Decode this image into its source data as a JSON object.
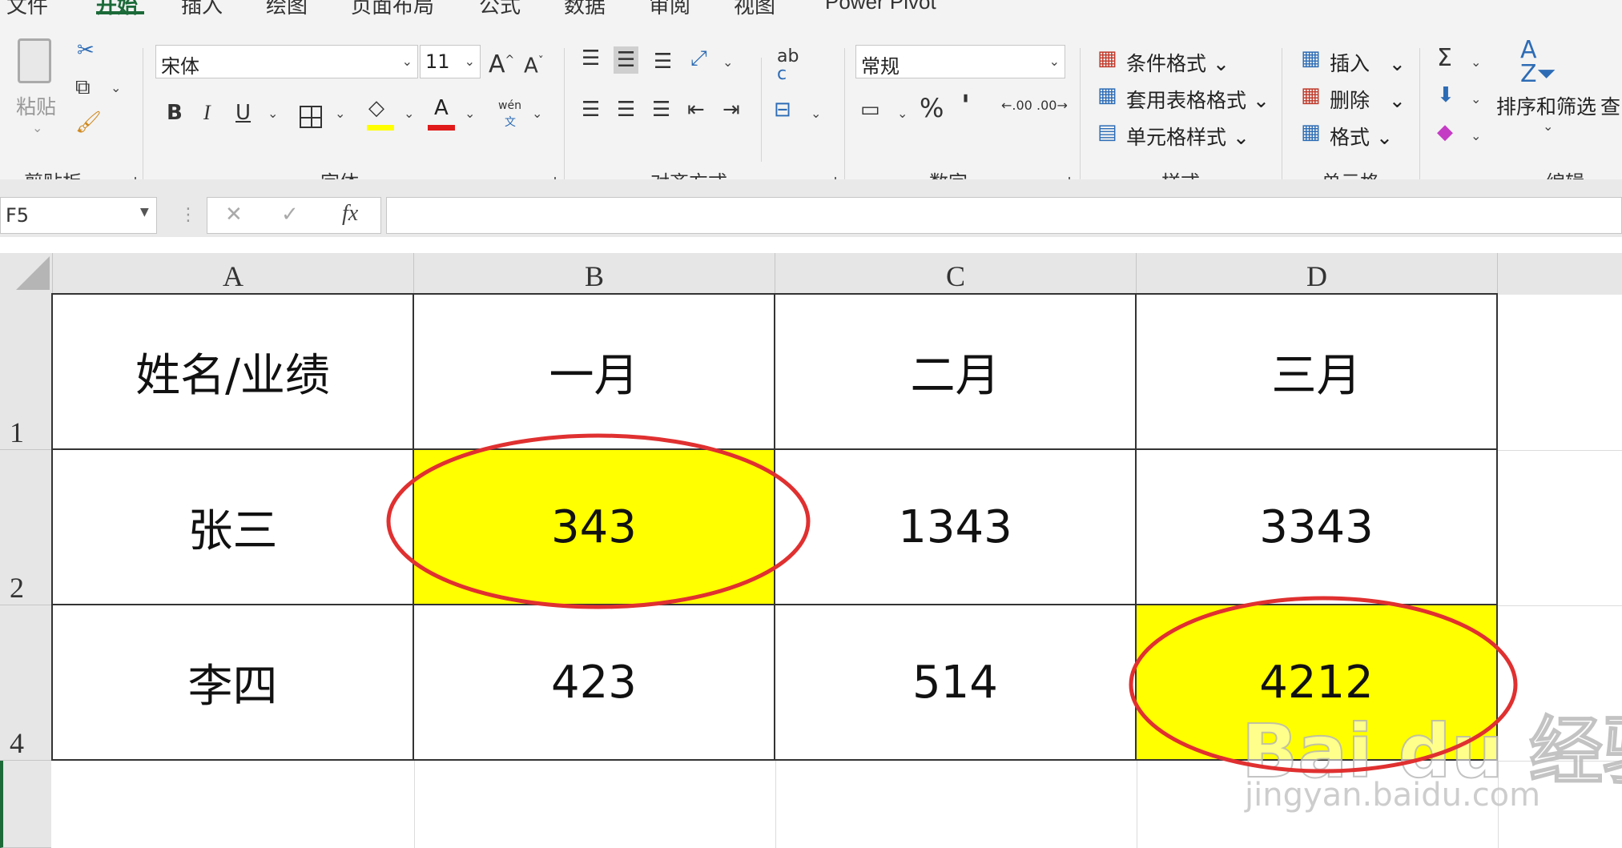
{
  "tabs": [
    "文件",
    "开始",
    "插入",
    "绘图",
    "页面布局",
    "公式",
    "数据",
    "审阅",
    "视图",
    "Power Pivot"
  ],
  "ribbon": {
    "clipboard": {
      "label": "剪贴板",
      "paste": "粘贴"
    },
    "font": {
      "label": "字体",
      "name": "宋体",
      "size": "11",
      "grow": "A",
      "shrink": "A",
      "bold": "B",
      "italic": "I",
      "underline": "U",
      "phonetic_top": "wén",
      "phonetic_bottom": "文",
      "font_color_letter": "A"
    },
    "align": {
      "label": "对齐方式",
      "wrap_top": "ab",
      "wrap_bottom": "c"
    },
    "number": {
      "label": "数字",
      "format": "常规",
      "percent": "%",
      "comma": "'",
      "inc_decimal": ".00",
      "dec_decimal": ".00"
    },
    "styles": {
      "label": "样式",
      "conditional": "条件格式",
      "table": "套用表格格式",
      "cell": "单元格样式"
    },
    "cells": {
      "label": "单元格",
      "insert": "插入",
      "delete": "删除",
      "format": "格式"
    },
    "editing": {
      "label": "编辑",
      "sum": "Σ",
      "sort": "排序和筛选",
      "find": "查"
    },
    "colors": {
      "accent": "#1b6a38",
      "highlight": "#ffff00",
      "font_red": "#e01a1a"
    }
  },
  "formula_bar": {
    "name_box": "F5",
    "cancel": "✕",
    "enter": "✓",
    "fx": "fx",
    "value": ""
  },
  "sheet": {
    "columns": [
      "A",
      "B",
      "C",
      "D"
    ],
    "rows": [
      "1",
      "2",
      "4"
    ],
    "cells": [
      [
        "姓名/业绩",
        "一月",
        "二月",
        "三月"
      ],
      [
        "张三",
        "343",
        "1343",
        "3343"
      ],
      [
        "李四",
        "423",
        "514",
        "4212"
      ]
    ],
    "highlighted": [
      "B2",
      "D4"
    ],
    "annotation_color": "#e03030"
  },
  "watermark": {
    "brand": "Bai du 经验",
    "url": "jingyan.baidu.com"
  }
}
